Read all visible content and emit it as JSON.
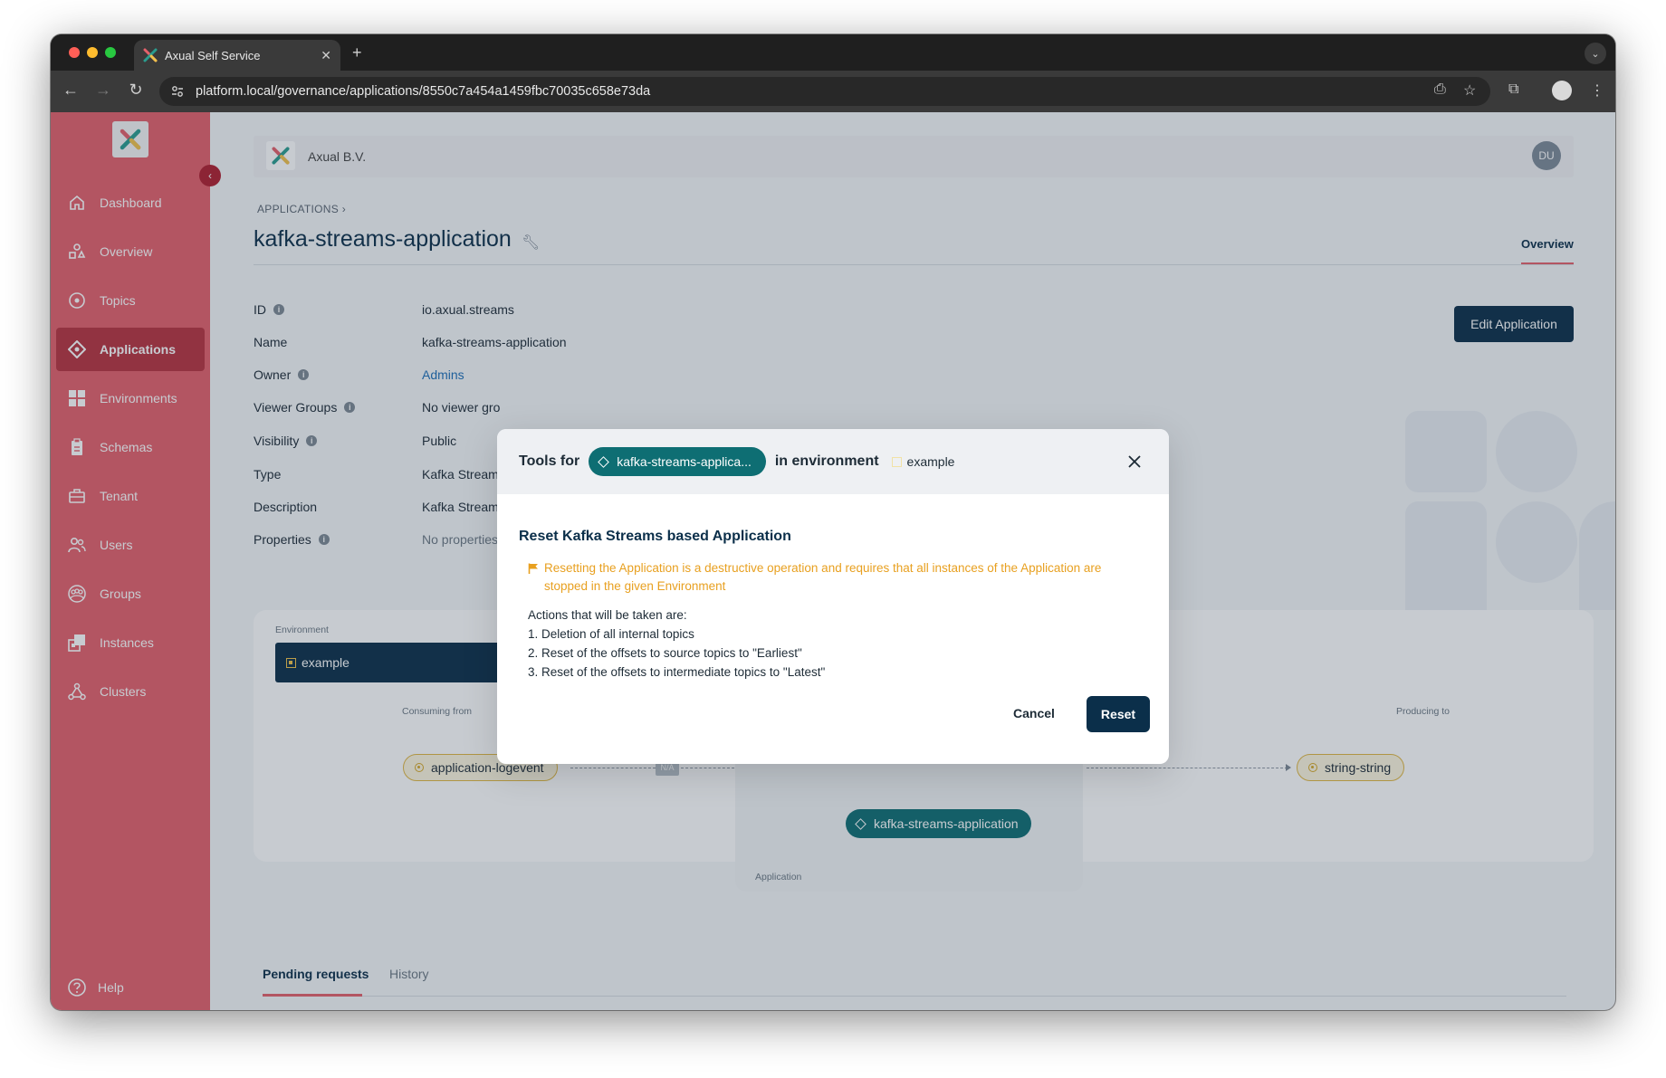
{
  "browser": {
    "tab_title": "Axual Self Service",
    "url": "platform.local/governance/applications/8550c7a454a1459fbc70035c658e73da",
    "new_tab_label": "+"
  },
  "sidebar": {
    "items": [
      {
        "label": "Dashboard",
        "icon": "home-icon"
      },
      {
        "label": "Overview",
        "icon": "shapes-icon"
      },
      {
        "label": "Topics",
        "icon": "target-icon"
      },
      {
        "label": "Applications",
        "icon": "diamond-icon"
      },
      {
        "label": "Environments",
        "icon": "grid-icon"
      },
      {
        "label": "Schemas",
        "icon": "clipboard-icon"
      },
      {
        "label": "Tenant",
        "icon": "briefcase-icon"
      },
      {
        "label": "Users",
        "icon": "users-icon"
      },
      {
        "label": "Groups",
        "icon": "group-icon"
      },
      {
        "label": "Instances",
        "icon": "instances-icon"
      },
      {
        "label": "Clusters",
        "icon": "cluster-icon"
      }
    ],
    "active": "Applications",
    "help_label": "Help"
  },
  "topbar": {
    "org_name": "Axual B.V.",
    "avatar_initials": "DU"
  },
  "page": {
    "breadcrumb": "APPLICATIONS",
    "title": "kafka-streams-application",
    "tab_overview": "Overview",
    "edit_button": "Edit Application"
  },
  "details": {
    "id_label": "ID",
    "id_value": "io.axual.streams",
    "name_label": "Name",
    "name_value": "kafka-streams-application",
    "owner_label": "Owner",
    "owner_value": "Admins",
    "viewer_label": "Viewer Groups",
    "viewer_value": "No viewer gro",
    "visibility_label": "Visibility",
    "visibility_value": "Public",
    "type_label": "Type",
    "type_value": "Kafka Stream",
    "description_label": "Description",
    "description_value": "Kafka Stream",
    "properties_label": "Properties",
    "properties_value": "No properties"
  },
  "environment_panel": {
    "caption": "Environment",
    "selected": "example",
    "consuming_caption": "Consuming from",
    "producing_caption": "Producing to",
    "source_topic": "application-logevent",
    "na_label": "N/A",
    "app_caption": "Application",
    "app_name": "kafka-streams-application",
    "target_topic": "string-string"
  },
  "bottom_tabs": {
    "pending": "Pending requests",
    "history": "History"
  },
  "modal": {
    "tools_for": "Tools for",
    "app_chip": "kafka-streams-applica...",
    "in_environment": "in environment",
    "environment": "example",
    "title": "Reset Kafka Streams based Application",
    "warning": "Resetting the Application is a destructive operation and requires that all instances of the Application are stopped in the given Environment",
    "actions_intro": "Actions that will be taken are:",
    "actions": [
      "1. Deletion of all internal topics",
      "2. Reset of the offsets to source topics to \"Earliest\"",
      "3. Reset of the offsets to intermediate topics to \"Latest\""
    ],
    "cancel_label": "Cancel",
    "reset_label": "Reset"
  },
  "colors": {
    "sidebar": "#e5616b",
    "sidebar_active": "#b8323f",
    "primary": "#0b2f4a",
    "app_pill": "#0e6e73",
    "warning": "#e8a020",
    "topic_border": "#e0b743"
  }
}
